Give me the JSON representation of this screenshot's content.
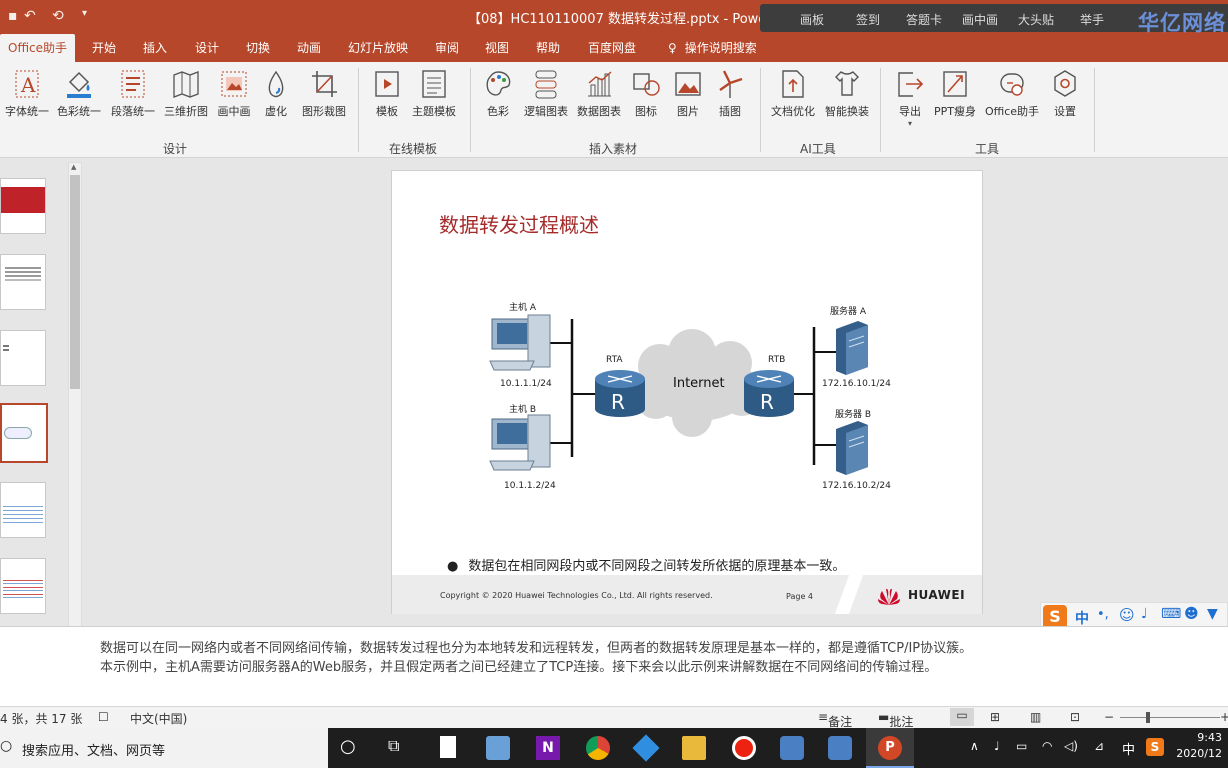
{
  "titlebar": {
    "document_title": "【08】HC110110007 数据转发过程.pptx - PowerPo",
    "brand": "华亿网络"
  },
  "overlay_toolbar": [
    "画板",
    "签到",
    "答题卡",
    "画中画",
    "大头贴",
    "举手"
  ],
  "tabs": [
    "Office助手",
    "开始",
    "插入",
    "设计",
    "切换",
    "动画",
    "幻灯片放映",
    "审阅",
    "视图",
    "帮助",
    "百度网盘",
    "操作说明搜索"
  ],
  "ribbon": {
    "buttons": [
      "字体统一",
      "色彩统一",
      "段落统一",
      "三维折图",
      "画中画",
      "虚化",
      "图形裁图",
      "模板",
      "主题模板",
      "色彩",
      "逻辑图表",
      "数据图表",
      "图标",
      "图片",
      "插图",
      "文档优化",
      "智能换装",
      "导出",
      "PPT瘦身",
      "Office助手",
      "设置"
    ],
    "groups": [
      "设计",
      "在线模板",
      "插入素材",
      "AI工具",
      "工具"
    ]
  },
  "slide": {
    "title": "数据转发过程概述",
    "host_a": "主机 A",
    "host_a_ip": "10.1.1.1/24",
    "host_b": "主机 B",
    "host_b_ip": "10.1.1.2/24",
    "rta": "RTA",
    "rtb": "RTB",
    "router_letter": "R",
    "cloud": "Internet",
    "server_a": "服务器 A",
    "server_a_ip": "172.16.10.1/24",
    "server_b": "服务器 B",
    "server_b_ip": "172.16.10.2/24",
    "bullet": "数据包在相同网段内或不同网段之间转发所依据的原理基本一致。",
    "copyright": "Copyright © 2020  Huawei Technologies Co., Ltd. All rights reserved.",
    "page": "Page 4",
    "logo": "HUAWEI"
  },
  "notes": [
    "数据可以在同一网络内或者不同网络间传输，数据转发过程也分为本地转发和远程转发，但两者的数据转发原理是基本一样的，都是遵循TCP/IP协议簇。",
    "本示例中，主机A需要访问服务器A的Web服务，并且假定两者之间已经建立了TCP连接。接下来会以此示例来讲解数据在不同网络间的传输过程。"
  ],
  "status": {
    "slide_count": "4 张，共 17 张",
    "language": "中文(中国)",
    "notes_btn": "备注",
    "comments_btn": "批注"
  },
  "taskbar": {
    "search_placeholder": "搜索应用、文档、网页等",
    "time": "9:43",
    "date": "2020/12",
    "ime": "中"
  },
  "ime_bar": "中"
}
